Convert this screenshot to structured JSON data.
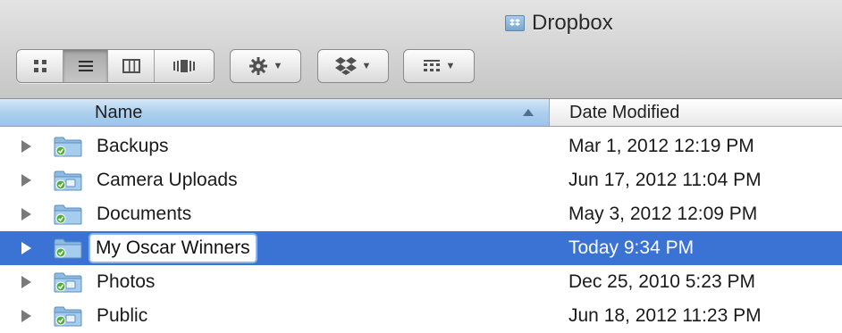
{
  "window": {
    "title": "Dropbox",
    "title_icon": "dropbox-folder-icon"
  },
  "toolbar": {
    "view_modes": [
      {
        "icon": "icon-view-icon",
        "active": false
      },
      {
        "icon": "list-view-icon",
        "active": true
      },
      {
        "icon": "column-view-icon",
        "active": false
      },
      {
        "icon": "cover-flow-view-icon",
        "active": false
      }
    ],
    "action_menu": {
      "icon": "gear-icon",
      "caret": "▼"
    },
    "dropbox_menu": {
      "icon": "dropbox-icon",
      "caret": "▼"
    },
    "arrange_menu": {
      "icon": "arrange-grid-icon",
      "caret": "▼"
    }
  },
  "columns": {
    "name": "Name",
    "date": "Date Modified",
    "sort": "ascending"
  },
  "files": [
    {
      "name": "Backups",
      "date": "Mar 1, 2012 12:19 PM",
      "selected": false,
      "badge": "synced-check"
    },
    {
      "name": "Camera Uploads",
      "date": "Jun 17, 2012 11:04 PM",
      "selected": false,
      "badge": "synced-check"
    },
    {
      "name": "Documents",
      "date": "May 3, 2012 12:09 PM",
      "selected": false,
      "badge": "synced-check"
    },
    {
      "name": "My Oscar Winners",
      "date": "Today 9:34 PM",
      "selected": true,
      "badge": "synced-check"
    },
    {
      "name": "Photos",
      "date": "Dec 25, 2010 5:23 PM",
      "selected": false,
      "badge": "synced-check"
    },
    {
      "name": "Public",
      "date": "Jun 18, 2012 11:23 PM",
      "selected": false,
      "badge": "synced-check"
    }
  ],
  "colors": {
    "selection": "#3a73d4",
    "header_sorted": "#acd0ee",
    "folder": "#7fb0d9",
    "sync_badge": "#4caf3a"
  }
}
